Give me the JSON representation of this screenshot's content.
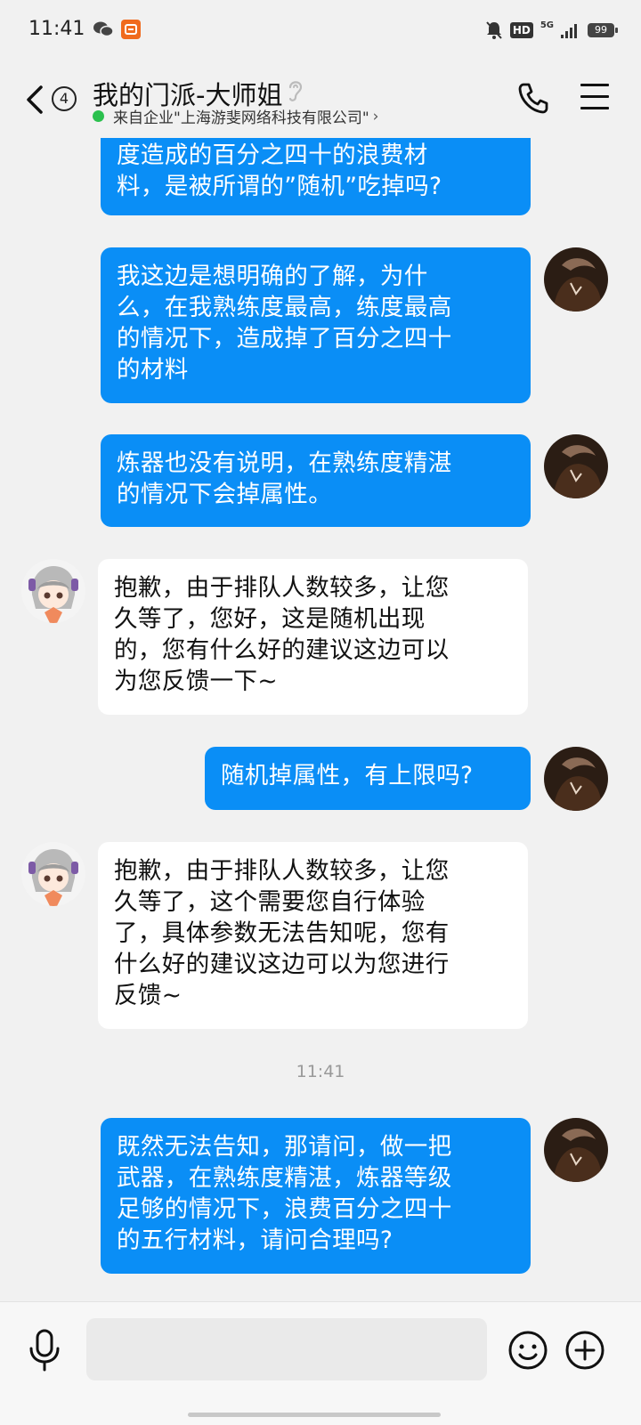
{
  "status_bar": {
    "time": "11:41",
    "network": "5G",
    "hd": "HD",
    "battery": "99",
    "icons": [
      "wechat-icon",
      "app-notification-icon",
      "mute-bell-icon",
      "hd-icon",
      "signal-icon",
      "battery-icon"
    ]
  },
  "header": {
    "unread_count": "4",
    "title": "我的门派-大师姐",
    "subtitle": "来自企业\"上海游斐网络科技有限公司\"",
    "subtitle_chevron": "›",
    "icons": [
      "back-icon",
      "ear-icon",
      "phone-icon",
      "menu-icon"
    ]
  },
  "messages": [
    {
      "id": "m0",
      "side": "out",
      "text": "度造成的百分之四十的浪费材\n料，是被所谓的”随机”吃掉吗?"
    },
    {
      "id": "m1",
      "side": "out",
      "text": "我这边是想明确的了解，为什\n么，在我熟练度最高，练度最高\n的情况下，造成掉了百分之四十\n的材料"
    },
    {
      "id": "m2",
      "side": "out",
      "text": "炼器也没有说明，在熟练度精湛\n的情况下会掉属性。"
    },
    {
      "id": "m3",
      "side": "in",
      "text": "抱歉，由于排队人数较多，让您\n久等了，您好，这是随机出现\n的，您有什么好的建议这边可以\n为您反馈一下~"
    },
    {
      "id": "m4",
      "side": "out",
      "text": "随机掉属性，有上限吗?"
    },
    {
      "id": "m5",
      "side": "in",
      "text": "抱歉，由于排队人数较多，让您\n久等了，这个需要您自行体验\n了，具体参数无法告知呢，您有\n什么好的建议这边可以为您进行\n反馈~"
    },
    {
      "id": "m6",
      "side": "out",
      "text": "既然无法告知，那请问，做一把\n武器，在熟练度精湛，炼器等级\n足够的情况下，浪费百分之四十\n的五行材料，请问合理吗?"
    }
  ],
  "timestamp": "11:41",
  "input_bar": {
    "placeholder": "",
    "icons": [
      "microphone-icon",
      "emoji-icon",
      "plus-icon"
    ]
  },
  "colors": {
    "outgoing_bubble": "#0a8ef6",
    "incoming_bubble": "#ffffff",
    "background": "#f1f1f1",
    "online_dot": "#2bc04e"
  }
}
